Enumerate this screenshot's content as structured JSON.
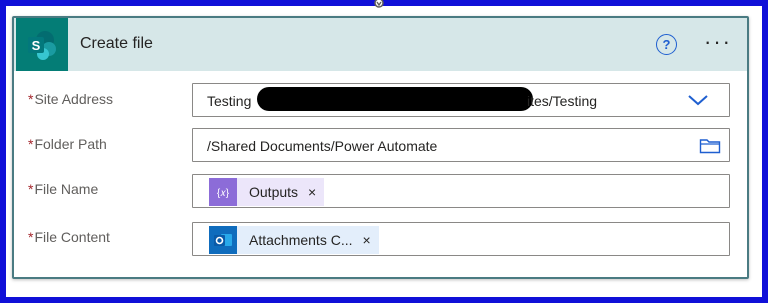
{
  "action": {
    "title": "Create file",
    "help_icon": "question-circle-icon",
    "more_icon": "ellipsis-icon",
    "more_label": "···"
  },
  "colors": {
    "frame": "#1010d8",
    "header_bg": "#d6e7e8",
    "sharepoint": "#047d76",
    "expression_token": "#8c6cd8",
    "outlook_token": "#0f6cbd",
    "required": "#a4262c"
  },
  "fields": {
    "site_address": {
      "label": "Site Address",
      "value_prefix": "Testing",
      "value_suffix": "ites/Testing",
      "control": "chevron-down-icon"
    },
    "folder_path": {
      "label": "Folder Path",
      "value": "/Shared Documents/Power Automate",
      "control": "folder-icon"
    },
    "file_name": {
      "label": "File Name",
      "token_label": "Outputs",
      "token_icon": "expression-icon",
      "remove": "×"
    },
    "file_content": {
      "label": "File Content",
      "token_label": "Attachments C...",
      "token_icon": "outlook-icon",
      "remove": "×"
    }
  },
  "required_marker": "*"
}
